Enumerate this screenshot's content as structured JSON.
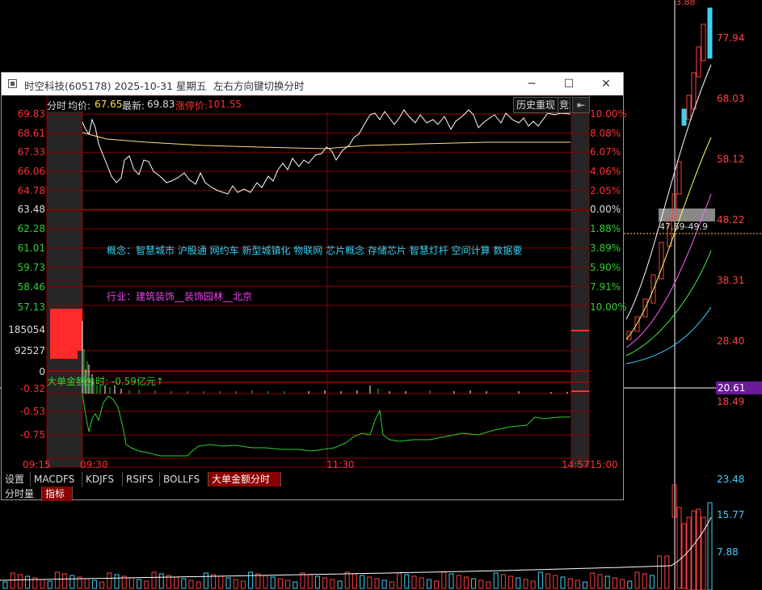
{
  "window": {
    "title": "时空科技(605178) 2025-10-31 星期五",
    "hint": "左右方向键切换分时",
    "controls": {
      "minimize": "─",
      "maximize": "☐",
      "close": "✕"
    }
  },
  "header": {
    "label": "分时",
    "avg_label": "均价:",
    "avg_value": "67.65",
    "latest_label": "最新:",
    "latest_value": "69.83",
    "limit_label": "涨停价:",
    "limit_value": "101.55",
    "history_btn": "历史重现",
    "jing_btn": "竞",
    "back_icon": "back-arrow-icon"
  },
  "price_axis_left": [
    "69.83",
    "68.61",
    "67.33",
    "66.06",
    "64.78",
    "63.48",
    "62.28",
    "61.01",
    "59.73",
    "58.46",
    "57.13"
  ],
  "price_axis_right": [
    "10.00%",
    "8.08%",
    "6.07%",
    "4.06%",
    "2.05%",
    "0.00%",
    "1.88%",
    "3.89%",
    "5.90%",
    "7.91%",
    "10.00%"
  ],
  "volume_axis": [
    "185054",
    "92527",
    "0"
  ],
  "info": {
    "concept": "概念：智慧城市  沪股通  网约车  新型城镇化  物联网  芯片概念  存储芯片  智慧灯杆  空间计算  数据要",
    "industry": "行业：建筑装饰__装饰园林__北京"
  },
  "bigorder": {
    "label": "大单金额分时: ",
    "value": "-0.59亿元↑",
    "axis": [
      "-0.32",
      "-0.53",
      "-0.75"
    ]
  },
  "time_axis": [
    "09:15",
    "09:30",
    "11:30",
    "14:57",
    "15:00"
  ],
  "tabs": [
    "设置",
    "MACDFS",
    "KDJFS",
    "RSIFS",
    "BOLLFS",
    "大单金额分时"
  ],
  "subtabs": [
    "分时量",
    "指标"
  ],
  "background": {
    "top_value": "3.88",
    "price_axis": [
      "77.94",
      "68.03",
      "58.12",
      "48.22",
      "38.31",
      "28.40",
      "18.49"
    ],
    "highlight": "20.61",
    "range_label": "47.69-49.9",
    "volume_axis": [
      "23.48",
      "15.77",
      "7.88"
    ]
  },
  "colors": {
    "up": "#ff3030",
    "down": "#30d030",
    "grid": "#8a0000",
    "bg": "#000000"
  }
}
